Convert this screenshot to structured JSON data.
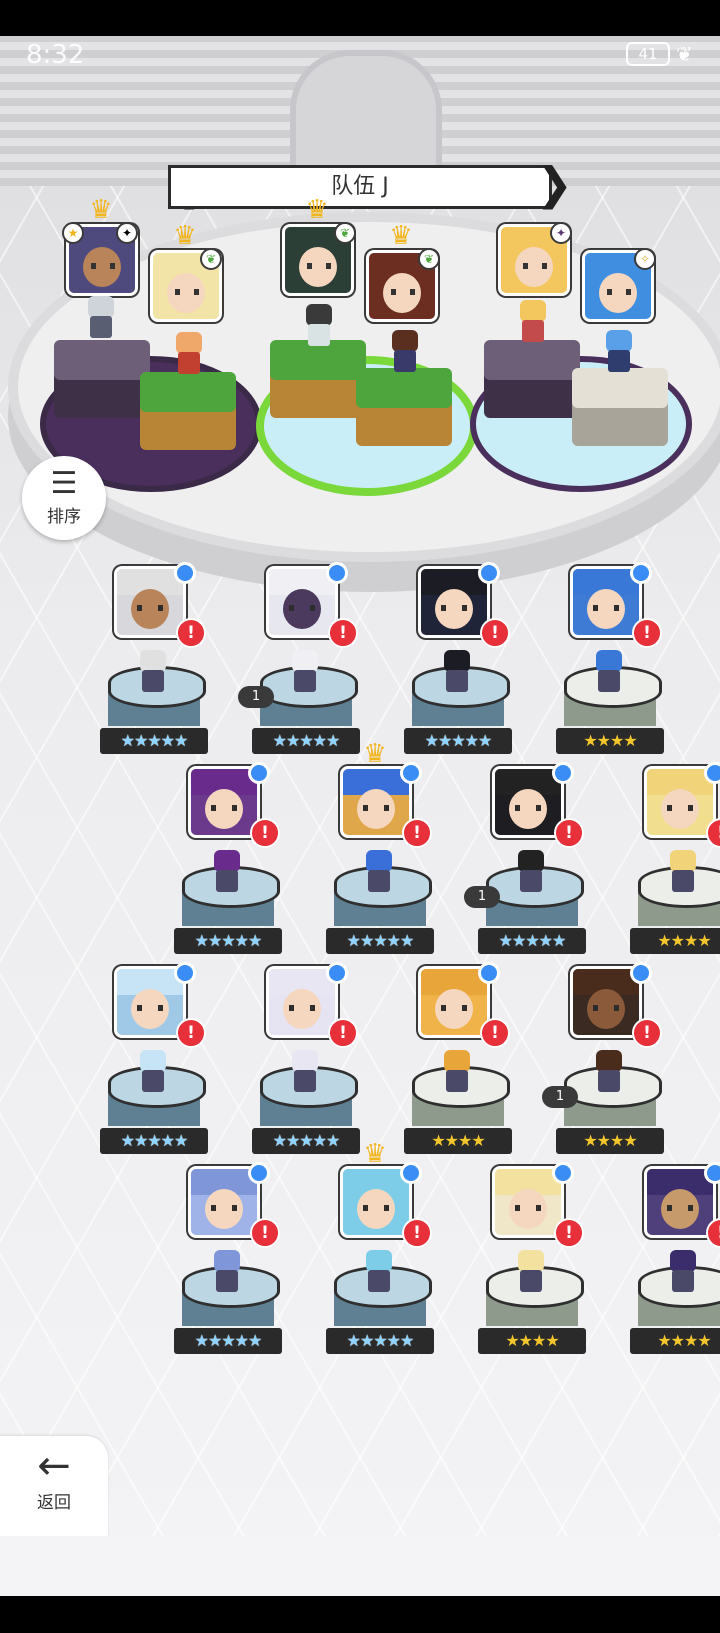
{
  "status": {
    "time": "8:32",
    "battery": "41"
  },
  "team": {
    "title": "队伍 J",
    "prev": "❮",
    "next": "❯"
  },
  "sort_button": {
    "label": "排序",
    "icon": "sort-icon"
  },
  "back_button": {
    "label": "返回",
    "icon": "arrow-left-icon"
  },
  "colors": {
    "warning": "#e8303b",
    "badge_blue": "#3a8df5",
    "crown": "#f2b51d",
    "star_gold": "#f3c62c"
  },
  "team_slots": [
    {
      "crown": true,
      "element": "dark"
    },
    {
      "crown": true,
      "element": "earth"
    },
    {
      "crown": true,
      "element": "earth"
    },
    {
      "crown": true,
      "element": "earth"
    },
    {
      "crown": false,
      "element": "dark"
    },
    {
      "crown": false,
      "element": "light"
    }
  ],
  "heroes": [
    {
      "stars": "★★★★★",
      "rainbow": true,
      "crown": false,
      "tag": ""
    },
    {
      "stars": "★★★★★",
      "rainbow": true,
      "crown": false,
      "tag": "1"
    },
    {
      "stars": "★★★★★",
      "rainbow": true,
      "crown": false,
      "tag": ""
    },
    {
      "stars": "★★★★",
      "rainbow": false,
      "crown": false,
      "tag": ""
    },
    {
      "stars": "★★★★★",
      "rainbow": true,
      "crown": false,
      "tag": ""
    },
    {
      "stars": "★★★★★",
      "rainbow": true,
      "crown": true,
      "tag": ""
    },
    {
      "stars": "★★★★★",
      "rainbow": true,
      "crown": false,
      "tag": "1"
    },
    {
      "stars": "★★★★",
      "rainbow": false,
      "crown": false,
      "tag": ""
    },
    {
      "stars": "★★★★★",
      "rainbow": true,
      "crown": false,
      "tag": ""
    },
    {
      "stars": "★★★★★",
      "rainbow": true,
      "crown": false,
      "tag": ""
    },
    {
      "stars": "★★★★",
      "rainbow": false,
      "crown": false,
      "tag": ""
    },
    {
      "stars": "★★★★",
      "rainbow": false,
      "crown": false,
      "tag": "1"
    },
    {
      "stars": "★★★★★",
      "rainbow": true,
      "crown": false,
      "tag": ""
    },
    {
      "stars": "★★★★★",
      "rainbow": true,
      "crown": true,
      "tag": ""
    },
    {
      "stars": "★★★★",
      "rainbow": false,
      "crown": false,
      "tag": ""
    },
    {
      "stars": "★★★★",
      "rainbow": false,
      "crown": false,
      "tag": ""
    }
  ],
  "warning_mark": "!",
  "crown_glyph": "♛"
}
